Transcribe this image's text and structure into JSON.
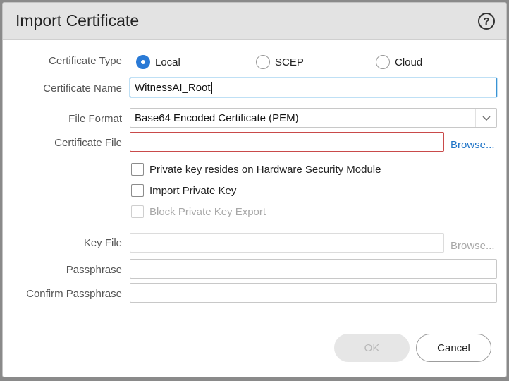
{
  "dialog": {
    "title": "Import Certificate",
    "help_icon": "question-circle-icon"
  },
  "labels": {
    "certificate_type": "Certificate Type",
    "certificate_name": "Certificate Name",
    "file_format": "File Format",
    "certificate_file": "Certificate File",
    "key_file": "Key File",
    "passphrase": "Passphrase",
    "confirm_passphrase": "Confirm Passphrase"
  },
  "certificate_type": {
    "options": [
      {
        "label": "Local",
        "checked": true
      },
      {
        "label": "SCEP",
        "checked": false
      },
      {
        "label": "Cloud",
        "checked": false
      }
    ]
  },
  "certificate_name": {
    "value": "WitnessAI_Root"
  },
  "file_format": {
    "selected": "Base64 Encoded Certificate (PEM)"
  },
  "certificate_file": {
    "value": "",
    "browse_label": "Browse..."
  },
  "checkboxes": {
    "hsm": {
      "label": "Private key resides on Hardware Security Module",
      "checked": false,
      "disabled": false
    },
    "import_private_key": {
      "label": "Import Private Key",
      "checked": false,
      "disabled": false
    },
    "block_export": {
      "label": "Block Private Key Export",
      "checked": false,
      "disabled": true
    }
  },
  "key_file": {
    "value": "",
    "browse_label": "Browse...",
    "disabled": true
  },
  "passphrase": {
    "value": ""
  },
  "confirm_passphrase": {
    "value": ""
  },
  "buttons": {
    "ok": {
      "label": "OK",
      "disabled": true
    },
    "cancel": {
      "label": "Cancel"
    }
  },
  "colors": {
    "accent": "#2a7ad6",
    "link": "#1f74c7",
    "error_border": "#c94a4a",
    "focus_border": "#3a93d4"
  }
}
